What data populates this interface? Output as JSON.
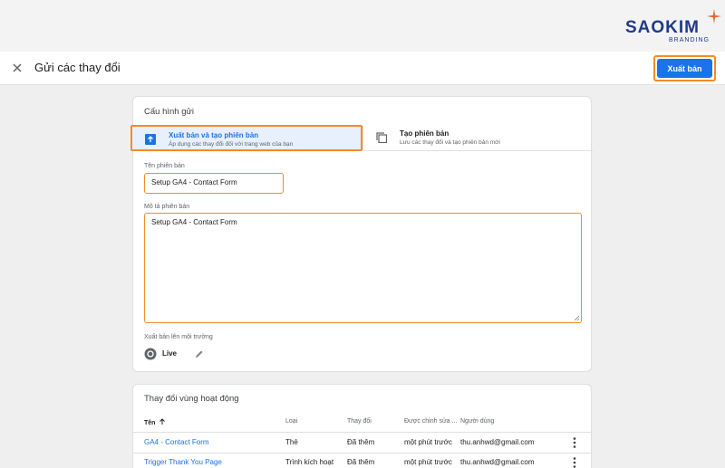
{
  "brand": {
    "name": "SAOKIM",
    "sub": "BRANDING"
  },
  "header": {
    "title": "Gửi các thay đổi",
    "publish_label": "Xuất bản"
  },
  "config": {
    "title": "Cấu hình gửi",
    "options": [
      {
        "title": "Xuất bản và tạo phiên bản",
        "subtitle": "Áp dụng các thay đổi đối với trang web của bạn",
        "selected": true
      },
      {
        "title": "Tạo phiên bản",
        "subtitle": "Lưu các thay đổi và tạo phiên bản mới",
        "selected": false
      }
    ],
    "version_name_label": "Tên phiên bản",
    "version_name_value": "Setup GA4 - Contact Form",
    "version_desc_label": "Mô tả phiên bản",
    "version_desc_value": "Setup GA4 - Contact Form",
    "env_label": "Xuất bản lên môi trường",
    "env_value": "Live"
  },
  "changes": {
    "title": "Thay đổi vùng hoạt động",
    "columns": [
      "Tên",
      "Loại",
      "Thay đổi",
      "Được chỉnh sửa ...",
      "Người dùng"
    ],
    "rows": [
      {
        "name": "GA4 - Contact Form",
        "type": "Thẻ",
        "change": "Đã thêm",
        "edited": "một phút trước",
        "user": "thu.anhwd@gmail.com"
      },
      {
        "name": "Trigger Thank You Page",
        "type": "Trình kích hoạt",
        "change": "Đã thêm",
        "edited": "một phút trước",
        "user": "thu.anhwd@gmail.com"
      }
    ]
  },
  "colors": {
    "accent": "#1a73e8",
    "highlight": "#f28c28",
    "brand": "#1e3a8a"
  }
}
